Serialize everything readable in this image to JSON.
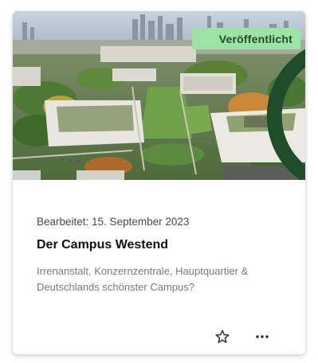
{
  "card": {
    "status": {
      "label": "Veröffentlicht",
      "icon": "globe-icon",
      "badge_color": "#9fe2a6"
    },
    "meta": "Bearbeitet: 15. September 2023",
    "title": "Der Campus Westend",
    "description": "Irrenanstalt, Konzernzentrale, Hauptquartier & Deutschlands schönster Campus?",
    "actions": [
      {
        "icon": "star-outline-icon"
      },
      {
        "icon": "more-horizontal-icon"
      }
    ],
    "image": {
      "subject": "aerial-photo-campus"
    }
  },
  "colors": {
    "text_primary": "#111111",
    "text_secondary": "#7a7a7a",
    "badge_bg": "#9fe2a6",
    "badge_text": "#1f4d2a"
  }
}
